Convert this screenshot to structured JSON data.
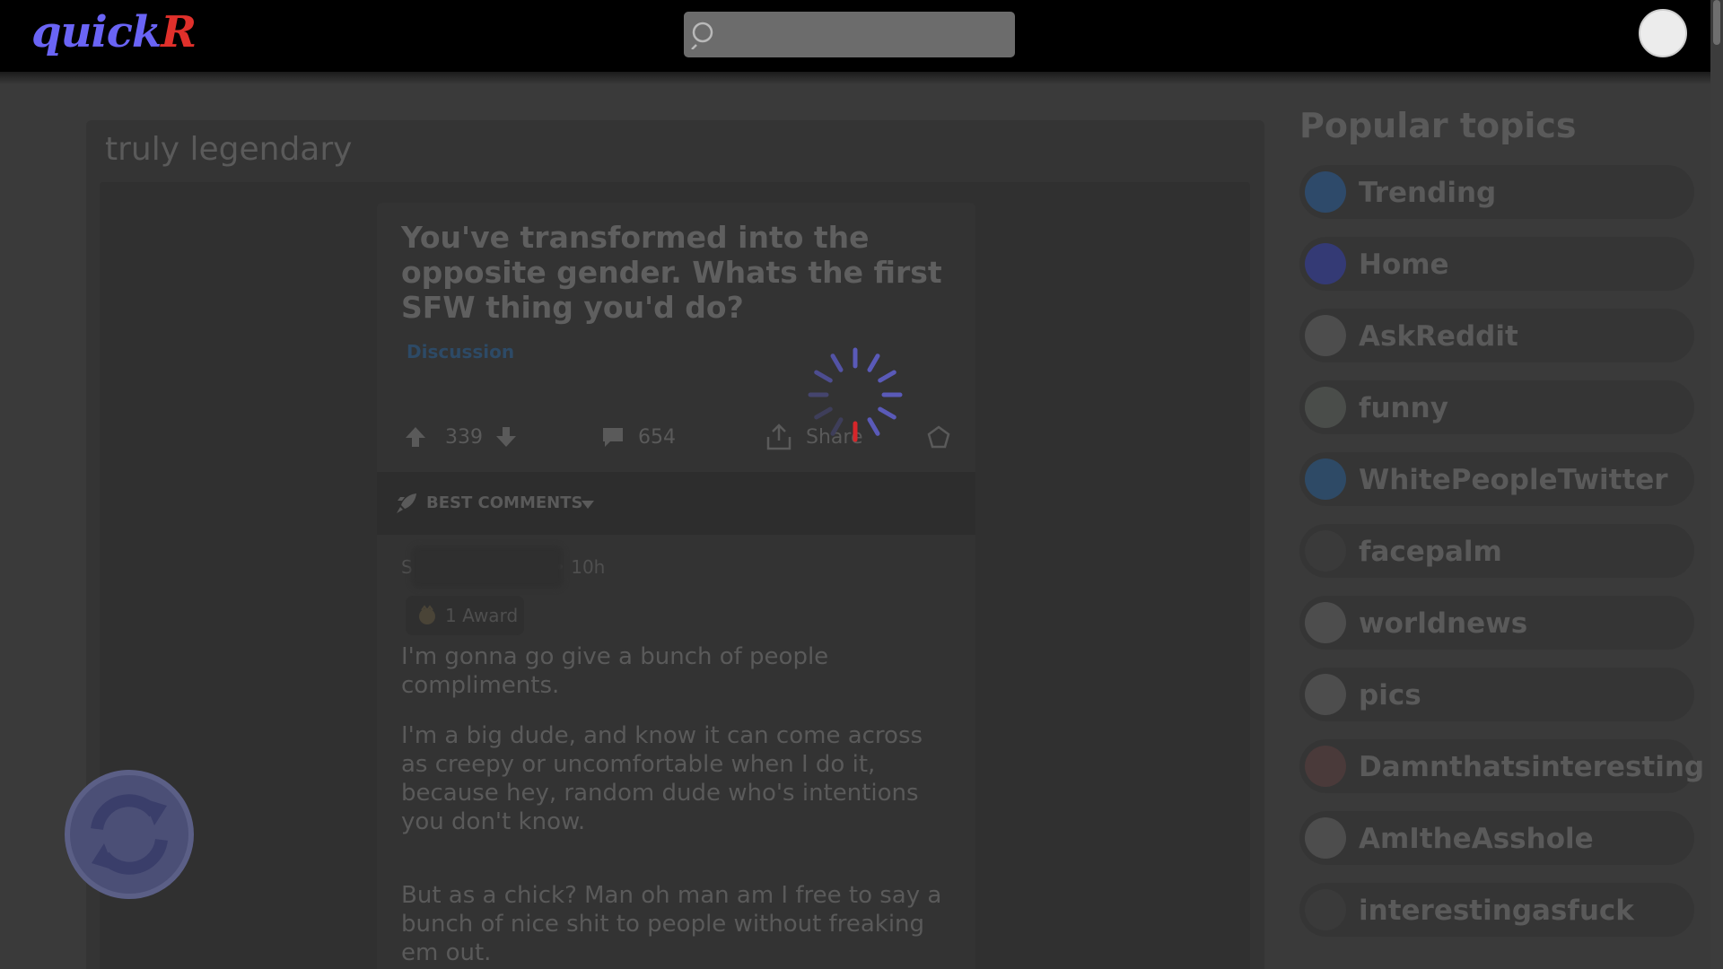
{
  "header": {
    "logo_part1": "quick",
    "logo_part2": "R",
    "search_placeholder": "",
    "colors": {
      "logo_primary": "#6a64f5",
      "logo_accent": "#e0302b"
    }
  },
  "feed": {
    "title": "truly legendary"
  },
  "post": {
    "title": "You've transformed into the opposite gender. Whats the first SFW thing you'd do?",
    "flair": "Discussion",
    "score": "339",
    "comments": "654",
    "share_label": "Share"
  },
  "comments_section": {
    "sort_label": "BEST COMMENTS",
    "first_comment": {
      "author_initial": "S",
      "time": "• 10h",
      "award_label": "1 Award",
      "paragraphs": [
        "I'm gonna go give a bunch of people compliments.",
        "I'm a big dude, and know it can come across as creepy or uncomfortable when I do it, because hey, random dude who's intentions you don't know.",
        "But as a chick? Man oh man am I free to say a bunch of nice shit to people without freaking em out."
      ]
    }
  },
  "sidebar": {
    "title": "Popular topics",
    "topics": [
      {
        "name": "Trending",
        "icon": "trending-icon",
        "color": "#2e4a6a"
      },
      {
        "name": "Home",
        "icon": "home-icon",
        "color": "#343a75"
      },
      {
        "name": "AskReddit",
        "icon": "askreddit-icon",
        "color": "#4d4d4d"
      },
      {
        "name": "funny",
        "icon": "funny-icon",
        "color": "#4a4d4a"
      },
      {
        "name": "WhitePeopleTwitter",
        "icon": "twitter-bird-icon",
        "color": "#2e4a66"
      },
      {
        "name": "facepalm",
        "icon": "facepalm-icon",
        "color": "#3a3a3a"
      },
      {
        "name": "worldnews",
        "icon": "megaphone-icon",
        "color": "#4d4d4d"
      },
      {
        "name": "pics",
        "icon": "camera-icon",
        "color": "#4d4d4d"
      },
      {
        "name": "Damnthatsinteresting",
        "icon": "interesting-icon",
        "color": "#4a3a3a"
      },
      {
        "name": "AmItheAsshole",
        "icon": "aita-icon",
        "color": "#4d4d4d"
      },
      {
        "name": "interestingasfuck",
        "icon": "interestingasfuck-icon",
        "color": "#3a3a3a"
      }
    ]
  }
}
